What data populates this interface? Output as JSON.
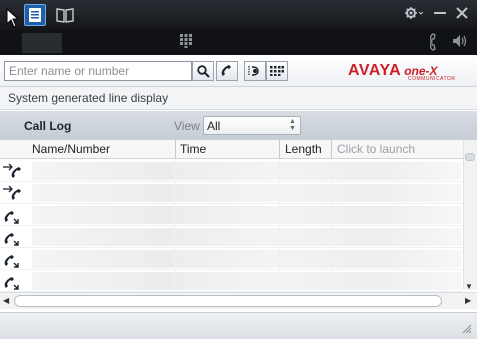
{
  "titlebar": {
    "contacts_icon": "contacts-list-icon",
    "directory_icon": "book-icon",
    "settings_icon": "gear-icon",
    "minimize_icon": "minimize-icon",
    "close_icon": "close-icon"
  },
  "strip": {
    "dialpad_icon": "dialpad-grid-icon",
    "handset_icon": "handset-icon",
    "volume_icon": "speaker-icon"
  },
  "search": {
    "placeholder": "Enter name or number",
    "value": ""
  },
  "logo": {
    "brand": "AVAYA",
    "product": "one-X",
    "subtitle": "COMMUNICATOR"
  },
  "line_display": {
    "text": "System generated line display"
  },
  "call_log": {
    "title": "Call Log",
    "view_label": "View",
    "view_selected": "All",
    "columns": [
      "Name/Number",
      "Time",
      "Length",
      "Click to launch"
    ],
    "rows": [
      {
        "type": "outgoing-call"
      },
      {
        "type": "outgoing-call"
      },
      {
        "type": "incoming-call"
      },
      {
        "type": "incoming-call"
      },
      {
        "type": "incoming-call"
      },
      {
        "type": "incoming-call"
      }
    ]
  },
  "colors": {
    "titlebar": "#1a1c20",
    "brand_red": "#cc1f2a",
    "active_tab": "#1f5fa8",
    "header_band": "#cdd2d9"
  }
}
